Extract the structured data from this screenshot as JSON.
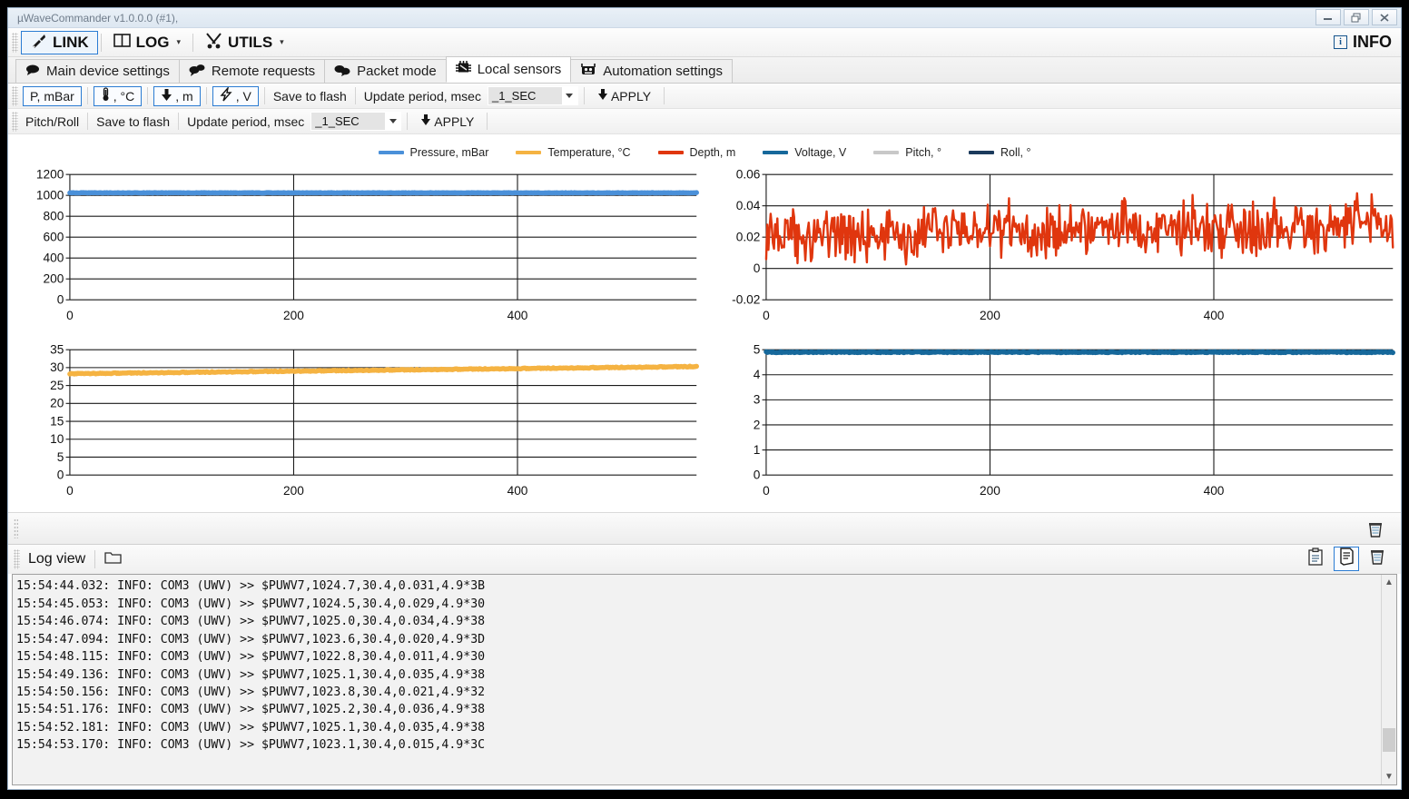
{
  "window": {
    "title": "µWaveCommander v1.0.0.0 (#1),",
    "controls": [
      {
        "name": "minimize",
        "glyph": "—"
      },
      {
        "name": "restore",
        "glyph": "❐"
      },
      {
        "name": "close",
        "glyph": "✕"
      }
    ]
  },
  "menu": {
    "items": [
      {
        "label": "LINK",
        "icon": "wrench-icon",
        "selected": true,
        "has_caret": false
      },
      {
        "label": "LOG",
        "icon": "book-icon",
        "selected": false,
        "has_caret": true
      },
      {
        "label": "UTILS",
        "icon": "tools-icon",
        "selected": false,
        "has_caret": true
      }
    ],
    "info_label": "INFO",
    "info_icon": "info-icon"
  },
  "tabs": [
    {
      "label": "Main device settings",
      "icon": "speech-bubble-icon",
      "active": false
    },
    {
      "label": "Remote requests",
      "icon": "two-bubbles-icon",
      "active": false
    },
    {
      "label": "Packet mode",
      "icon": "packets-icon",
      "active": false
    },
    {
      "label": "Local sensors",
      "icon": "chip-icon",
      "active": true
    },
    {
      "label": "Automation settings",
      "icon": "robot-icon",
      "active": false
    }
  ],
  "toolbar_sensors": {
    "buttons": [
      {
        "label": "P, mBar",
        "icon": "",
        "active": true
      },
      {
        "label": ", °C",
        "icon": "thermometer-icon",
        "active": true
      },
      {
        "label": ", m",
        "icon": "down-arrow-icon",
        "active": true
      },
      {
        "label": ", V",
        "icon": "lightning-icon",
        "active": true
      }
    ],
    "save_to_flash": "Save to flash",
    "update_period_label": "Update period, msec",
    "update_period_value": "_1_SEC",
    "apply_label": "APPLY"
  },
  "toolbar_pitchroll": {
    "pitch_roll_label": "Pitch/Roll",
    "save_to_flash": "Save to flash",
    "update_period_label": "Update period, msec",
    "update_period_value": "_1_SEC",
    "apply_label": "APPLY"
  },
  "legend": [
    {
      "label": "Pressure, mBar",
      "color": "#4a90d9"
    },
    {
      "label": "Temperature, °C",
      "color": "#f5b342"
    },
    {
      "label": "Depth, m",
      "color": "#e0360e"
    },
    {
      "label": "Voltage, V",
      "color": "#16689b"
    },
    {
      "label": "Pitch, °",
      "color": "#c8c8c8"
    },
    {
      "label": "Roll, °",
      "color": "#1b3a5c"
    }
  ],
  "chart_data": [
    {
      "type": "line",
      "name": "pressure-chart",
      "title": "",
      "series": [
        {
          "name": "Pressure, mBar",
          "color": "#4a90d9",
          "level": 1024.3,
          "noise": 2.0
        }
      ],
      "xlabel": "",
      "ylabel": "",
      "xticks": [
        0,
        200,
        400
      ],
      "yticks": [
        0,
        200,
        400,
        600,
        800,
        1000,
        1200
      ],
      "ytick_labels": [
        "0",
        "200",
        "400",
        "600",
        "800",
        "1000",
        "1200"
      ],
      "xlim": [
        0,
        560
      ],
      "ylim": [
        0,
        1200
      ],
      "grid": true,
      "legend": "top-shared"
    },
    {
      "type": "line",
      "name": "depth-chart",
      "title": "",
      "series": [
        {
          "name": "Depth, m",
          "color": "#e0360e",
          "level": 0.022,
          "noise": 0.018
        }
      ],
      "xlabel": "",
      "ylabel": "",
      "xticks": [
        0,
        200,
        400
      ],
      "yticks": [
        -0.02,
        0,
        0.02,
        0.04,
        0.06
      ],
      "ytick_labels": [
        "-0.02",
        "0",
        "0.02",
        "0.04",
        "0.06"
      ],
      "xlim": [
        0,
        560
      ],
      "ylim": [
        -0.02,
        0.06
      ],
      "grid": true,
      "legend": "top-shared"
    },
    {
      "type": "line",
      "name": "temperature-chart",
      "title": "",
      "series": [
        {
          "name": "Temperature, °C",
          "color": "#f5b342",
          "start": 28.3,
          "end": 30.3
        }
      ],
      "xlabel": "",
      "ylabel": "",
      "xticks": [
        0,
        200,
        400
      ],
      "yticks": [
        0,
        5,
        10,
        15,
        20,
        25,
        30,
        35
      ],
      "ytick_labels": [
        "0",
        "5",
        "10",
        "15",
        "20",
        "25",
        "30",
        "35"
      ],
      "xlim": [
        0,
        560
      ],
      "ylim": [
        0,
        35
      ],
      "grid": true,
      "legend": "top-shared"
    },
    {
      "type": "line",
      "name": "voltage-chart",
      "title": "",
      "series": [
        {
          "name": "Voltage, V",
          "color": "#16689b",
          "level": 4.9,
          "noise": 0.02
        }
      ],
      "xlabel": "",
      "ylabel": "",
      "xticks": [
        0,
        200,
        400
      ],
      "yticks": [
        0,
        1,
        2,
        3,
        4,
        5
      ],
      "ytick_labels": [
        "0",
        "1",
        "2",
        "3",
        "4",
        "5"
      ],
      "xlim": [
        0,
        560
      ],
      "ylim": [
        0,
        5
      ],
      "grid": true,
      "legend": "top-shared"
    }
  ],
  "splitbar": {
    "trash_icon": "trash-icon"
  },
  "logview": {
    "title": "Log view",
    "folder_icon": "folder-icon",
    "icons": [
      {
        "name": "clipboard-icon",
        "active": false
      },
      {
        "name": "document-icon",
        "active": true
      },
      {
        "name": "trash-icon",
        "active": false
      }
    ],
    "lines": [
      "15:54:44.032: INFO: COM3 (UWV) >> $PUWV7,1024.7,30.4,0.031,4.9*3B",
      "15:54:45.053: INFO: COM3 (UWV) >> $PUWV7,1024.5,30.4,0.029,4.9*30",
      "15:54:46.074: INFO: COM3 (UWV) >> $PUWV7,1025.0,30.4,0.034,4.9*38",
      "15:54:47.094: INFO: COM3 (UWV) >> $PUWV7,1023.6,30.4,0.020,4.9*3D",
      "15:54:48.115: INFO: COM3 (UWV) >> $PUWV7,1022.8,30.4,0.011,4.9*30",
      "15:54:49.136: INFO: COM3 (UWV) >> $PUWV7,1025.1,30.4,0.035,4.9*38",
      "15:54:50.156: INFO: COM3 (UWV) >> $PUWV7,1023.8,30.4,0.021,4.9*32",
      "15:54:51.176: INFO: COM3 (UWV) >> $PUWV7,1025.2,30.4,0.036,4.9*38",
      "15:54:52.181: INFO: COM3 (UWV) >> $PUWV7,1025.1,30.4,0.035,4.9*38",
      "15:54:53.170: INFO: COM3 (UWV) >> $PUWV7,1023.1,30.4,0.015,4.9*3C"
    ],
    "scrollbar": {
      "up": "▲",
      "down": "▼"
    }
  }
}
